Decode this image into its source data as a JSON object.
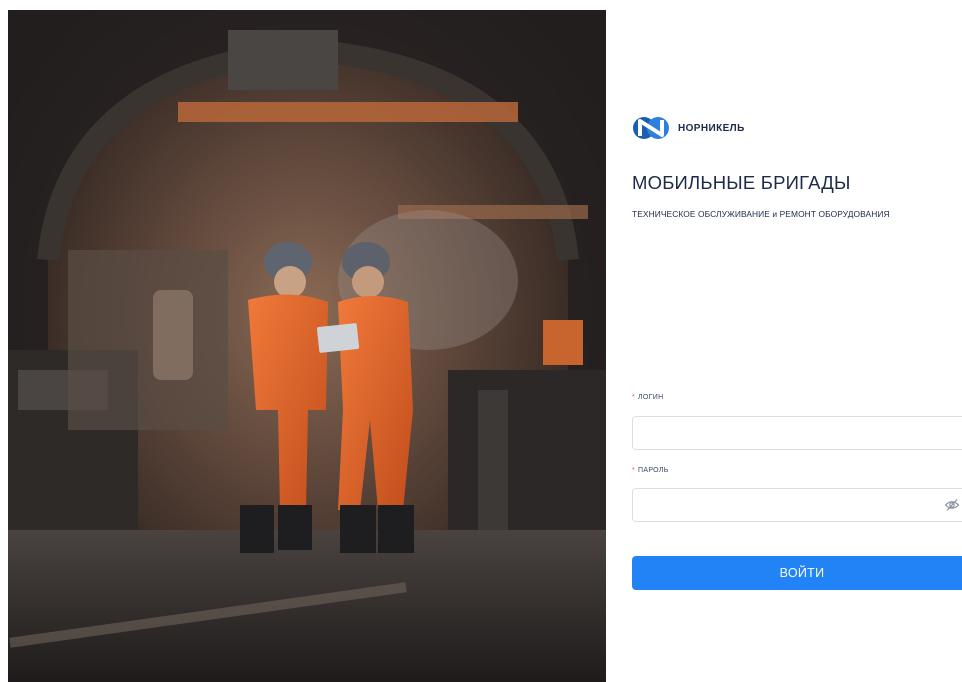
{
  "brand": {
    "name": "НОРНИКЕЛЬ",
    "logo_colors": [
      "#1a5fb4",
      "#2d7fe0"
    ]
  },
  "app": {
    "title": "МОБИЛЬНЫЕ БРИГАДЫ",
    "subtitle": "ТЕХНИЧЕСКОЕ ОБСЛУЖИВАНИЕ и РЕМОНТ ОБОРУДОВАНИЯ"
  },
  "form": {
    "required_mark": "*",
    "login": {
      "label": "ЛОГИН",
      "value": "",
      "placeholder": ""
    },
    "password": {
      "label": "ПАРОЛЬ",
      "value": "",
      "placeholder": "",
      "toggle_icon": "eye-off-icon"
    },
    "submit_label": "ВОЙТИ"
  },
  "colors": {
    "accent": "#2283f6",
    "required": "#e5544f",
    "text": "#1d2a4a"
  }
}
